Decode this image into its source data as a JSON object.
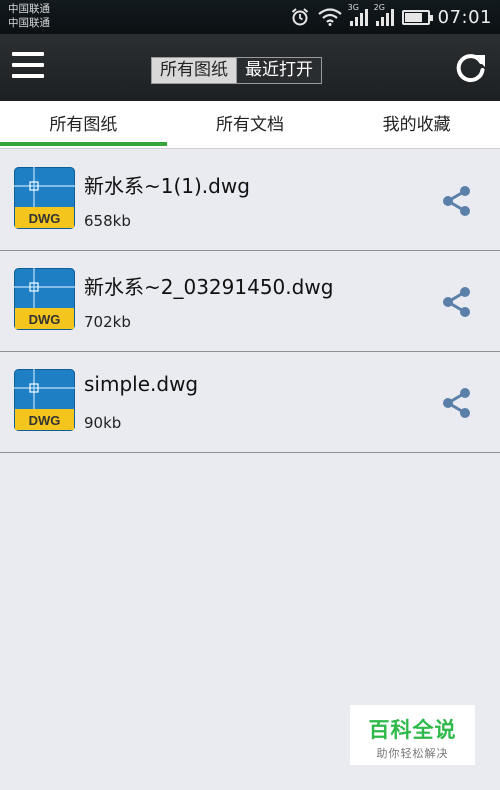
{
  "status_bar": {
    "carrier1": "中国联通",
    "carrier2": "中国联通",
    "network1": "3G",
    "network2": "2G",
    "battery_level": 0.8,
    "time": "07:01"
  },
  "toolbar": {
    "seg_all": "所有图纸",
    "seg_recent": "最近打开"
  },
  "tabs": [
    "所有图纸",
    "所有文档",
    "我的收藏"
  ],
  "files": [
    {
      "name": "新水系~1(1).dwg",
      "size": "658kb"
    },
    {
      "name": "新水系~2_03291450.dwg",
      "size": "702kb"
    },
    {
      "name": "simple.dwg",
      "size": "90kb"
    }
  ],
  "file_icon_label": "DWG",
  "icons": {
    "menu": "hamburger-menu-icon",
    "refresh": "refresh-icon",
    "share": "share-icon",
    "file": "dwg-file-icon"
  },
  "colors": {
    "accent_green": "#35a53a",
    "share_blue": "#5a7fa8",
    "file_blue": "#1f7fc4",
    "file_yellow": "#f3c51d"
  },
  "watermark": {
    "title": "百科全说",
    "subtitle": "助你轻松解决"
  }
}
